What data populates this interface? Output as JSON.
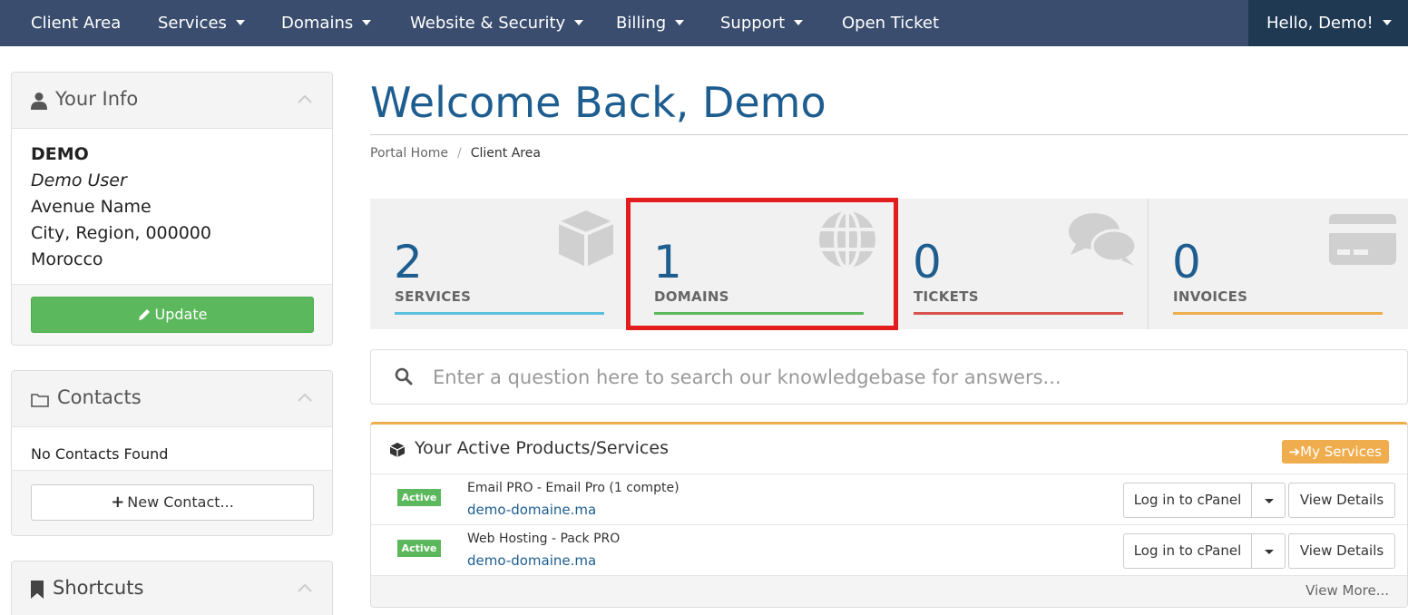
{
  "nav": {
    "items": [
      {
        "label": "Client Area",
        "dropdown": false
      },
      {
        "label": "Services",
        "dropdown": true
      },
      {
        "label": "Domains",
        "dropdown": true
      },
      {
        "label": "Website & Security",
        "dropdown": true
      },
      {
        "label": "Billing",
        "dropdown": true
      },
      {
        "label": "Support",
        "dropdown": true
      },
      {
        "label": "Open Ticket",
        "dropdown": false
      }
    ],
    "user_label": "Hello, Demo!"
  },
  "sidebar": {
    "your_info": {
      "title": "Your Info",
      "name": "DEMO",
      "role": "Demo User",
      "address": "Avenue Name",
      "city": "City, Region, 000000",
      "country": "Morocco",
      "button": "Update"
    },
    "contacts": {
      "title": "Contacts",
      "empty_text": "No Contacts Found",
      "button": "New Contact..."
    },
    "shortcuts": {
      "title": "Shortcuts"
    }
  },
  "main": {
    "title": "Welcome Back, Demo",
    "breadcrumb": [
      "Portal Home",
      "Client Area"
    ],
    "tiles": [
      {
        "count": "2",
        "label": "SERVICES",
        "icon": "cube-icon",
        "color": "#5bc0de"
      },
      {
        "count": "1",
        "label": "DOMAINS",
        "icon": "globe-icon",
        "color": "#5cb85c"
      },
      {
        "count": "0",
        "label": "TICKETS",
        "icon": "comments-icon",
        "color": "#d9534f"
      },
      {
        "count": "0",
        "label": "INVOICES",
        "icon": "credit-card-icon",
        "color": "#f0ad4e"
      }
    ],
    "search": {
      "placeholder": "Enter a question here to search our knowledgebase for answers..."
    },
    "products": {
      "title": "Your Active Products/Services",
      "my_services_button": "My Services",
      "rows": [
        {
          "status": "Active",
          "name": "Email PRO - Email Pro (1 compte)",
          "domain": "demo-domaine.ma",
          "login_button": "Log in to cPanel",
          "details_button": "View Details"
        },
        {
          "status": "Active",
          "name": "Web Hosting - Pack PRO",
          "domain": "demo-domaine.ma",
          "login_button": "Log in to cPanel",
          "details_button": "View Details"
        }
      ],
      "view_more": "View More..."
    }
  },
  "colors": {
    "navbar": "#3a4d6e",
    "navbar_user": "#1f3953",
    "title_blue": "#1d5d8f",
    "success": "#5cb85c",
    "warning": "#f0ad4e",
    "highlight": "#e31d1d"
  }
}
